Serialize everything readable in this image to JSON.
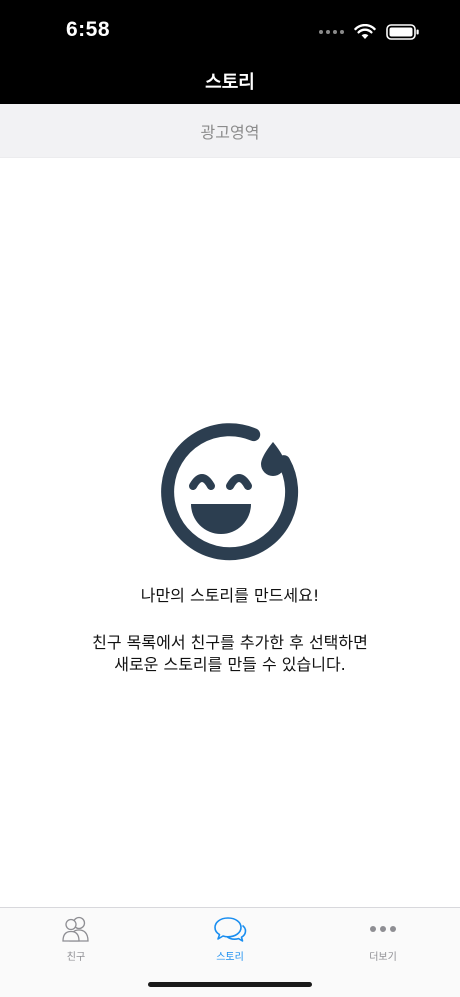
{
  "status_bar": {
    "time": "6:58"
  },
  "nav": {
    "title": "스토리"
  },
  "ad": {
    "label": "광고영역"
  },
  "empty_state": {
    "title": "나만의 스토리를 만드세요!",
    "description": "친구 목록에서 친구를 추가한 후 선택하면 새로운 스토리를 만들 수 있습니다."
  },
  "tabs": [
    {
      "label": "친구",
      "icon": "friends-icon",
      "active": false
    },
    {
      "label": "스토리",
      "icon": "chat-bubbles-icon",
      "active": true
    },
    {
      "label": "더보기",
      "icon": "more-dots-icon",
      "active": false
    }
  ],
  "colors": {
    "header_bg": "#000000",
    "ad_bg": "#f2f2f4",
    "emoji": "#2c3e50",
    "tab_active": "#1a8ef0",
    "tab_inactive": "#8e8e93"
  }
}
